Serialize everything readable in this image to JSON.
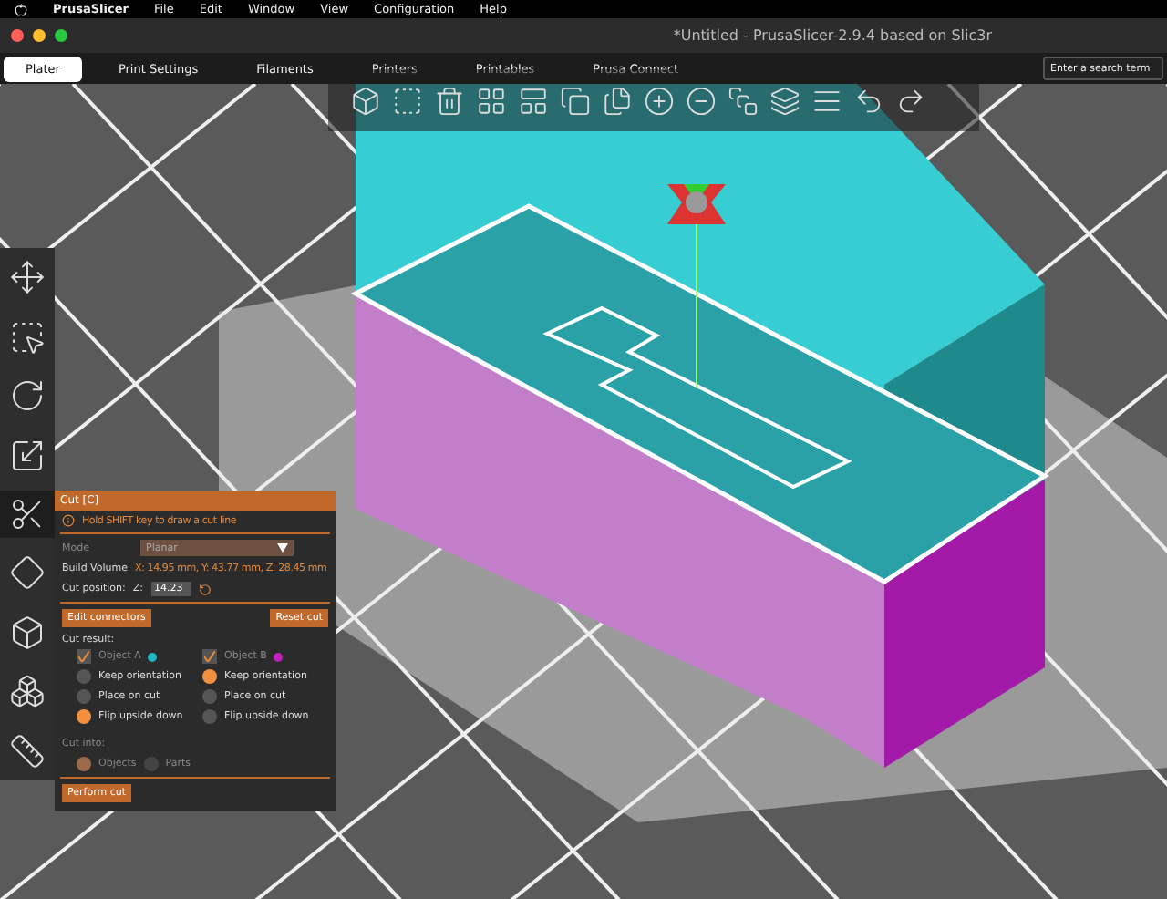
{
  "menu_bar": {
    "app": "PrusaSlicer",
    "items": [
      "File",
      "Edit",
      "Window",
      "View",
      "Configuration",
      "Help"
    ]
  },
  "window": {
    "title": "*Untitled - PrusaSlicer-2.9.4 based on Slic3r"
  },
  "tabs": [
    {
      "label": "Plater",
      "selected": true
    },
    {
      "label": "Print Settings",
      "selected": false
    },
    {
      "label": "Filaments",
      "selected": false
    },
    {
      "label": "Printers",
      "selected": false
    },
    {
      "label": "Printables",
      "selected": false
    },
    {
      "label": "Prusa Connect",
      "selected": false
    }
  ],
  "search": {
    "placeholder": "Enter a search term"
  },
  "cut_panel": {
    "title": "Cut [C]",
    "hint": "Hold SHIFT key to draw a cut line",
    "mode_label": "Mode",
    "mode_value": "Planar",
    "build_volume_label": "Build Volume",
    "build_volume_value": "X: 14.95 mm,  Y: 43.77 mm,  Z: 28.45 mm",
    "cut_position_label": "Cut position:",
    "axis": "Z:",
    "cut_position_value": "14.23",
    "edit_button": "Edit connectors",
    "reset_button": "Reset cut",
    "cut_result_label": "Cut result:",
    "objects": [
      {
        "name": "Object A",
        "checked": true,
        "color": "#1fb5c0",
        "options": [
          {
            "label": "Keep orientation",
            "selected": false
          },
          {
            "label": "Place on cut",
            "selected": false
          },
          {
            "label": "Flip upside down",
            "selected": true
          }
        ]
      },
      {
        "name": "Object B",
        "checked": true,
        "color": "#c020c0",
        "options": [
          {
            "label": "Keep orientation",
            "selected": true
          },
          {
            "label": "Place on cut",
            "selected": false
          },
          {
            "label": "Flip upside down",
            "selected": false
          }
        ]
      }
    ],
    "cut_into_label": "Cut into:",
    "cut_into": [
      {
        "label": "Objects",
        "selected": true
      },
      {
        "label": "Parts",
        "selected": false
      }
    ],
    "perform_button": "Perform cut"
  }
}
